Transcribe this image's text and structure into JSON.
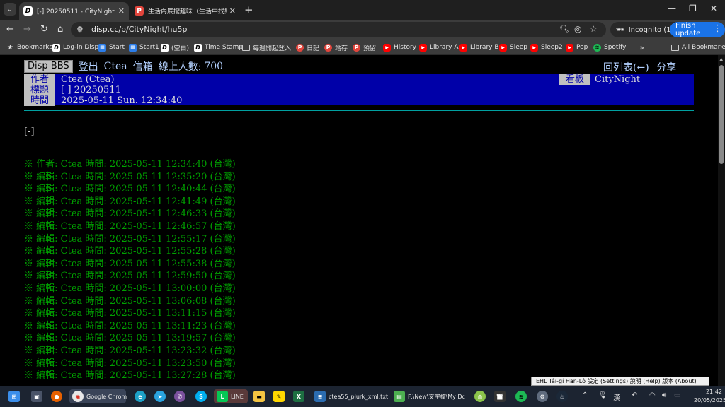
{
  "tabs": [
    {
      "title": "[-] 20250511 - CityNight板 - Di",
      "favicon": "D"
    },
    {
      "title": "生活內底攏趣味（生活中找樂趣",
      "favicon": "P"
    }
  ],
  "toolbar": {
    "url": "disp.cc/b/CityNight/hu5p",
    "incognito_label": "Incognito (10)",
    "finish_update_label": "Finish update"
  },
  "bookmarks": [
    {
      "label": "Bookmarks",
      "icon": "star-icon",
      "cls": "star",
      "glyph": "★"
    },
    {
      "label": "Log-in Disp",
      "icon": "disp-icon",
      "cls": "d",
      "glyph": "D"
    },
    {
      "label": "Start",
      "icon": "start-icon",
      "cls": "start",
      "glyph": "▦"
    },
    {
      "label": "Start1",
      "icon": "start-icon",
      "cls": "start",
      "glyph": "▦"
    },
    {
      "label": "(空白)",
      "icon": "disp-icon",
      "cls": "d",
      "glyph": "D"
    },
    {
      "label": "Time Stamp",
      "icon": "disp-icon",
      "cls": "d",
      "glyph": "D"
    },
    {
      "label": "每週開起登入",
      "icon": "folder-icon",
      "cls": "folder",
      "glyph": ""
    },
    {
      "label": "日記",
      "icon": "plurk-icon",
      "cls": "red",
      "glyph": "P"
    },
    {
      "label": "站存",
      "icon": "plurk-icon",
      "cls": "red",
      "glyph": "P"
    },
    {
      "label": "預留",
      "icon": "plurk-icon",
      "cls": "red",
      "glyph": "P"
    },
    {
      "label": "History",
      "icon": "youtube-icon",
      "cls": "yt",
      "glyph": "▶"
    },
    {
      "label": "Library A",
      "icon": "youtube-icon",
      "cls": "yt",
      "glyph": "▶"
    },
    {
      "label": "Library B",
      "icon": "youtube-icon",
      "cls": "yt",
      "glyph": "▶"
    },
    {
      "label": "Sleep",
      "icon": "youtube-icon",
      "cls": "yt",
      "glyph": "▶"
    },
    {
      "label": "Sleep2",
      "icon": "youtube-icon",
      "cls": "yt",
      "glyph": "▶"
    },
    {
      "label": "Pop",
      "icon": "youtube-icon",
      "cls": "yt",
      "glyph": "▶"
    },
    {
      "label": "Spotify",
      "icon": "spotify-icon",
      "cls": "sp",
      "glyph": "≋"
    }
  ],
  "all_bookmarks_label": "All Bookmarks",
  "bbs": {
    "disp_bbs": "Disp BBS",
    "logout": "登出",
    "user": "Ctea",
    "mailbox": "信箱",
    "online_label": "線上人數:",
    "online_count": "700",
    "back_to_list": "回列表(←)",
    "share": "分享",
    "author_label": "作者",
    "author": "Ctea (Ctea)",
    "title_label": "標題",
    "title": "[-] 20250511",
    "time_label": "時間",
    "time": "2025-05-11 Sun. 12:34:40",
    "board_label": "看板",
    "board": "CityNight",
    "body": "[-]",
    "sig_sep": "--",
    "edit_lines": [
      "※ 作者: Ctea 時間: 2025-05-11 12:34:40 (台灣)",
      "※ 編輯: Ctea 時間: 2025-05-11 12:35:20 (台灣)",
      "※ 編輯: Ctea 時間: 2025-05-11 12:40:44 (台灣)",
      "※ 編輯: Ctea 時間: 2025-05-11 12:41:49 (台灣)",
      "※ 編輯: Ctea 時間: 2025-05-11 12:46:33 (台灣)",
      "※ 編輯: Ctea 時間: 2025-05-11 12:46:57 (台灣)",
      "※ 編輯: Ctea 時間: 2025-05-11 12:55:17 (台灣)",
      "※ 編輯: Ctea 時間: 2025-05-11 12:55:28 (台灣)",
      "※ 編輯: Ctea 時間: 2025-05-11 12:55:38 (台灣)",
      "※ 編輯: Ctea 時間: 2025-05-11 12:59:50 (台灣)",
      "※ 編輯: Ctea 時間: 2025-05-11 13:00:00 (台灣)",
      "※ 編輯: Ctea 時間: 2025-05-11 13:06:08 (台灣)",
      "※ 編輯: Ctea 時間: 2025-05-11 13:11:15 (台灣)",
      "※ 編輯: Ctea 時間: 2025-05-11 13:11:23 (台灣)",
      "※ 編輯: Ctea 時間: 2025-05-11 13:19:57 (台灣)",
      "※ 編輯: Ctea 時間: 2025-05-11 13:23:32 (台灣)",
      "※ 編輯: Ctea 時間: 2025-05-11 13:23:50 (台灣)",
      "※ 編輯: Ctea 時間: 2025-05-11 13:27:28 (台灣)"
    ]
  },
  "ime_bar": "EHL  Tâi-gí Hàn-Lô  設定 (Settings)  說明 (Help)  版本 (About)",
  "taskbar": {
    "chrome_label": "Google Chrom",
    "line_label": "LINE",
    "file1_label": "ctea55_plurk_xml.txt",
    "file2_label": "F:\\New\\文字檔\\My Dc",
    "time": "21:42",
    "date": "20/05/2025"
  },
  "colors": {
    "bbs_header_bg": "#0000a8",
    "sig_green": "#00a000",
    "link_blue": "#b3d1ff",
    "finish_update_bg": "#1a73e8"
  }
}
